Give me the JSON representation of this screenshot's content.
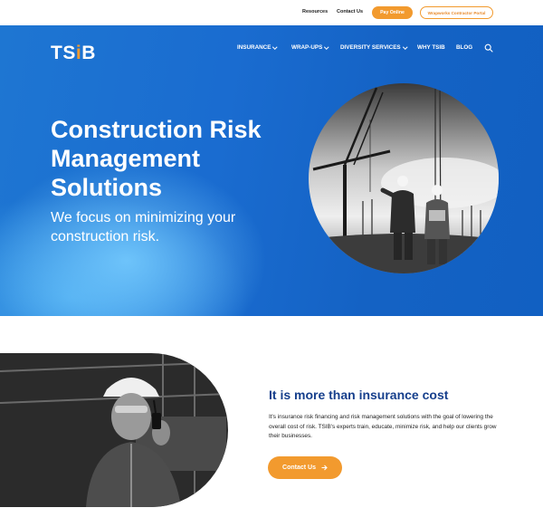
{
  "topbar": {
    "resources": "Resources",
    "contact": "Contact Us",
    "pay_online": "Pay Online",
    "contractor_portal": "Wrapworks Contractor Portal"
  },
  "brand": {
    "logo_prefix": "TS",
    "logo_accent": "i",
    "logo_suffix": "B",
    "accent_color": "#f29a2e",
    "primary_color": "#1a6cd0"
  },
  "nav": {
    "items": [
      {
        "label": "INSURANCE"
      },
      {
        "label": "WRAP-UPS"
      },
      {
        "label": "DIVERSITY SERVICES"
      },
      {
        "label": "WHY TSIB"
      },
      {
        "label": "BLOG"
      }
    ],
    "search_icon": "search-icon"
  },
  "hero": {
    "title": "Construction Risk Management Solutions",
    "subtitle": "We focus on minimizing your construction risk."
  },
  "section": {
    "title": "It is more than insurance cost",
    "body": "It's insurance risk financing and risk management solutions with the goal of lowering the overall cost of risk. TSIB's experts train, educate, minimize risk, and help our clients grow their businesses.",
    "cta": "Contact Us"
  }
}
